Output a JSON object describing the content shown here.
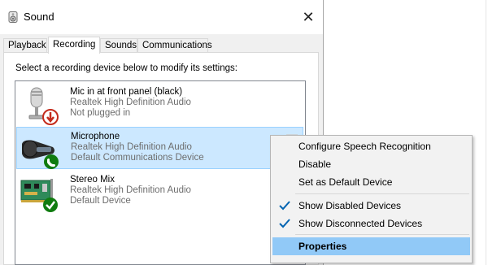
{
  "window": {
    "title": "Sound",
    "close_glyph": "✕"
  },
  "tabs": [
    {
      "label": "Playback"
    },
    {
      "label": "Recording",
      "active": true
    },
    {
      "label": "Sounds"
    },
    {
      "label": "Communications"
    }
  ],
  "instruction": "Select a recording device below to modify its settings:",
  "devices": [
    {
      "name": "Mic in at front panel (black)",
      "driver": "Realtek High Definition Audio",
      "status": "Not plugged in",
      "icon": "microphone-unplugged-icon",
      "badge_color": "#c42b1c"
    },
    {
      "name": "Microphone",
      "driver": "Realtek High Definition Audio",
      "status": "Default Communications Device",
      "icon": "microphone-icon",
      "badge_color": "#107c10",
      "selected": true
    },
    {
      "name": "Stereo Mix",
      "driver": "Realtek High Definition Audio",
      "status": "Default Device",
      "icon": "sound-card-icon",
      "badge_color": "#107c10"
    }
  ],
  "context_menu": {
    "items": [
      {
        "label": "Configure Speech Recognition"
      },
      {
        "label": "Disable"
      },
      {
        "label": "Set as Default Device"
      },
      {
        "label": "Show Disabled Devices",
        "checked": true
      },
      {
        "label": "Show Disconnected Devices",
        "checked": true
      },
      {
        "label": "Properties",
        "bold": true,
        "highlighted": true
      }
    ]
  },
  "colors": {
    "selection": "#cce8ff",
    "menu_highlight": "#91c9f7",
    "check": "#0063b1"
  }
}
